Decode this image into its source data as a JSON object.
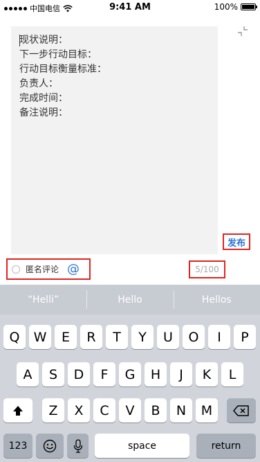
{
  "status_bar": {
    "carrier": "中国电信",
    "time": "9:41 AM",
    "battery_text": "100%"
  },
  "editor": {
    "lines": [
      "现状说明：",
      "下一步行动目标：",
      "行动目标衡量标准：",
      "负责人：",
      "完成时间：",
      "备注说明："
    ]
  },
  "publish_label": "发布",
  "anonymous_label": "匿名评论",
  "mention_symbol": "@",
  "counter": "5/100",
  "keyboard": {
    "suggestions": [
      "“Helli”",
      "Hello",
      "Hellos"
    ],
    "row1": [
      "Q",
      "W",
      "E",
      "R",
      "T",
      "Y",
      "U",
      "O",
      "I",
      "P"
    ],
    "row2": [
      "A",
      "S",
      "D",
      "F",
      "G",
      "H",
      "J",
      "K",
      "L"
    ],
    "row3": [
      "Z",
      "X",
      "C",
      "V",
      "B",
      "N",
      "M"
    ],
    "numbers_label": "123",
    "space_label": "space",
    "return_label": "return"
  },
  "colors": {
    "accent_blue": "#2b74d6",
    "highlight_red": "#e0231f",
    "editor_bg": "#f2f2f2",
    "keyboard_bg": "#d1d4da"
  }
}
